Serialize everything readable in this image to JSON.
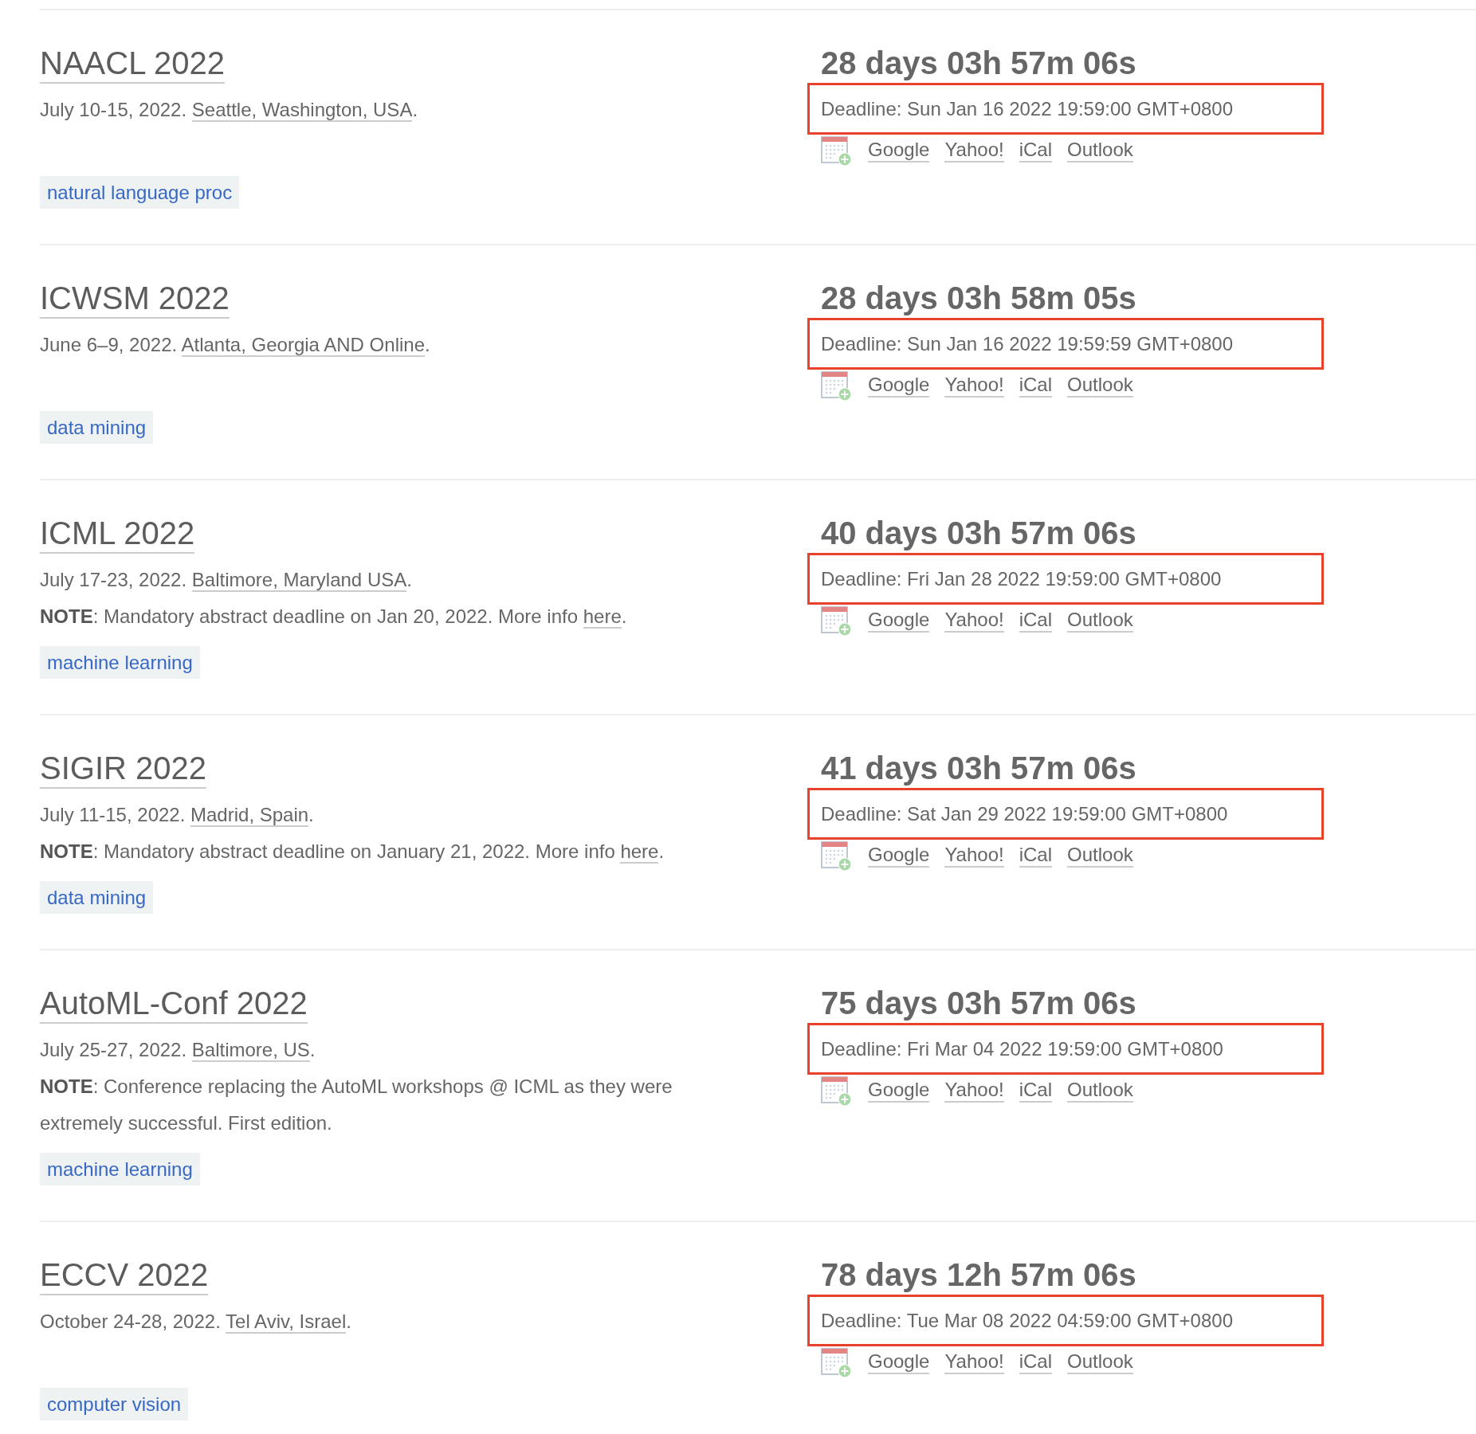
{
  "conferences": [
    {
      "title": "NAACL 2022",
      "date_line": [
        {
          "kind": "text",
          "text": "July 10-15, 2022. "
        },
        {
          "kind": "link",
          "text": "Seattle, Washington, USA"
        },
        {
          "kind": "text",
          "text": "."
        }
      ],
      "tags": [
        "natural language proc"
      ],
      "countdown": "28 days 03h 57m 06s",
      "deadline": {
        "text": "Deadline: Sun Jan 16 2022 19:59:00 GMT+0800",
        "highlighted": true
      },
      "calendar_links": [
        "Google",
        "Yahoo!",
        "iCal",
        "Outlook"
      ]
    },
    {
      "title": "ICWSM 2022",
      "date_line": [
        {
          "kind": "text",
          "text": "June 6–9, 2022. "
        },
        {
          "kind": "link",
          "text": "Atlanta, Georgia AND Online"
        },
        {
          "kind": "text",
          "text": "."
        }
      ],
      "tags": [
        "data mining"
      ],
      "countdown": "28 days 03h 58m 05s",
      "deadline": {
        "text": "Deadline: Sun Jan 16 2022 19:59:59 GMT+0800",
        "highlighted": true
      },
      "calendar_links": [
        "Google",
        "Yahoo!",
        "iCal",
        "Outlook"
      ]
    },
    {
      "title": "ICML 2022",
      "date_line": [
        {
          "kind": "text",
          "text": "July 17-23, 2022. "
        },
        {
          "kind": "link",
          "text": "Baltimore, Maryland USA"
        },
        {
          "kind": "text",
          "text": "."
        }
      ],
      "note": [
        {
          "kind": "text",
          "text": "**NOTE**: Mandatory abstract deadline on Jan 20, 2022. More info "
        },
        {
          "kind": "link",
          "text": "here"
        },
        {
          "kind": "text",
          "text": "."
        }
      ],
      "tags": [
        "machine learning"
      ],
      "countdown": "40 days 03h 57m 06s",
      "deadline": {
        "text": "Deadline: Fri Jan 28 2022 19:59:00 GMT+0800",
        "highlighted": true
      },
      "calendar_links": [
        "Google",
        "Yahoo!",
        "iCal",
        "Outlook"
      ]
    },
    {
      "title": "SIGIR 2022",
      "date_line": [
        {
          "kind": "text",
          "text": "July 11-15, 2022. "
        },
        {
          "kind": "link",
          "text": "Madrid, Spain"
        },
        {
          "kind": "text",
          "text": "."
        }
      ],
      "note": [
        {
          "kind": "text",
          "text": "**NOTE**: Mandatory abstract deadline on January 21, 2022. More info "
        },
        {
          "kind": "link",
          "text": "here"
        },
        {
          "kind": "text",
          "text": "."
        }
      ],
      "tags": [
        "data mining"
      ],
      "countdown": "41 days 03h 57m 06s",
      "deadline": {
        "text": "Deadline: Sat Jan 29 2022 19:59:00 GMT+0800",
        "highlighted": true
      },
      "calendar_links": [
        "Google",
        "Yahoo!",
        "iCal",
        "Outlook"
      ]
    },
    {
      "title": "AutoML-Conf 2022",
      "date_line": [
        {
          "kind": "text",
          "text": "July 25-27, 2022. "
        },
        {
          "kind": "link",
          "text": "Baltimore, US"
        },
        {
          "kind": "text",
          "text": "."
        }
      ],
      "note": [
        {
          "kind": "text",
          "text": "**NOTE**: Conference replacing the AutoML workshops @ ICML as they were extremely successful. First edition."
        }
      ],
      "tags": [
        "machine learning"
      ],
      "countdown": "75 days 03h 57m 06s",
      "deadline": {
        "text": "Deadline: Fri Mar 04 2022 19:59:00 GMT+0800",
        "highlighted": true
      },
      "calendar_links": [
        "Google",
        "Yahoo!",
        "iCal",
        "Outlook"
      ]
    },
    {
      "title": "ECCV 2022",
      "date_line": [
        {
          "kind": "text",
          "text": "October 24-28, 2022. "
        },
        {
          "kind": "link",
          "text": "Tel Aviv, Israel"
        },
        {
          "kind": "text",
          "text": "."
        }
      ],
      "tags": [
        "computer vision"
      ],
      "countdown": "78 days 12h 57m 06s",
      "deadline": {
        "text": "Deadline: Tue Mar 08 2022 04:59:00 GMT+0800",
        "highlighted": true
      },
      "calendar_links": [
        "Google",
        "Yahoo!",
        "iCal",
        "Outlook"
      ]
    }
  ]
}
